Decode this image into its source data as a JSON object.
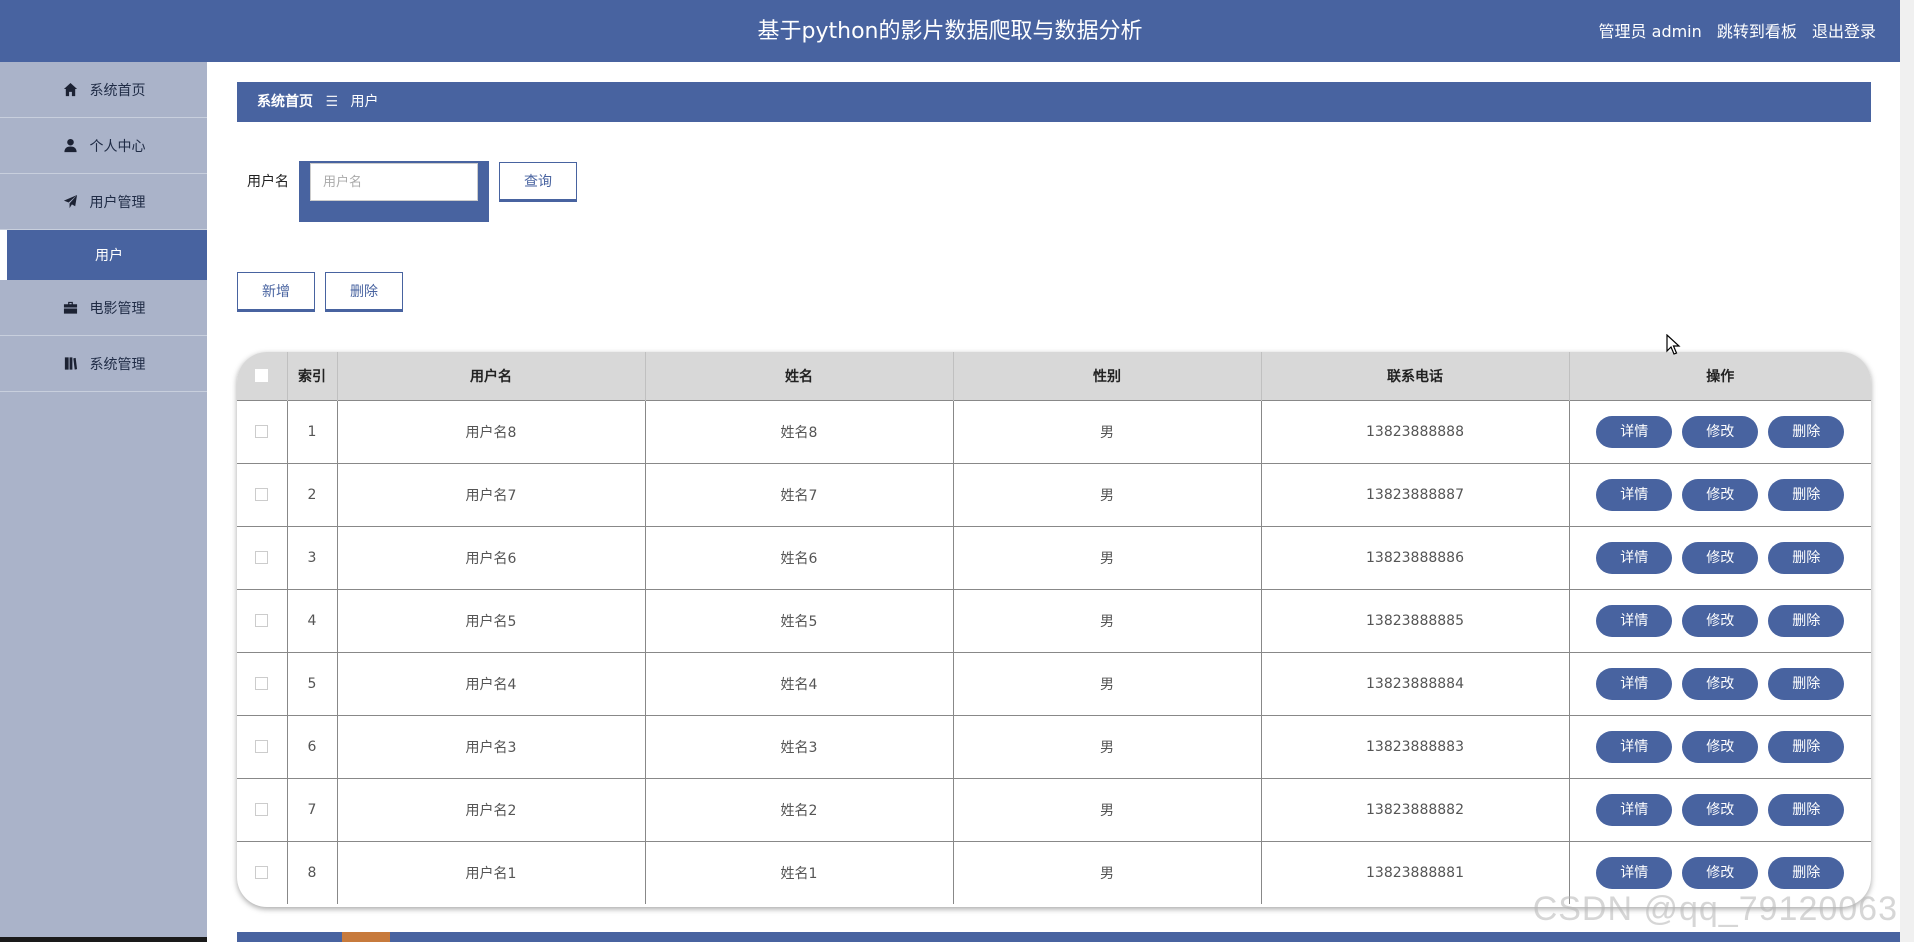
{
  "header": {
    "title": "基于python的影片数据爬取与数据分析",
    "admin_label": "管理员 admin",
    "dashboard_link": "跳转到看板",
    "logout_link": "退出登录"
  },
  "sidebar": {
    "items": [
      {
        "label": "系统首页",
        "icon": "home-icon"
      },
      {
        "label": "个人中心",
        "icon": "user-icon"
      },
      {
        "label": "用户管理",
        "icon": "paper-plane-icon"
      },
      {
        "label": "用户",
        "icon": ""
      },
      {
        "label": "电影管理",
        "icon": "briefcase-icon"
      },
      {
        "label": "系统管理",
        "icon": "book-icon"
      }
    ]
  },
  "breadcrumb": {
    "home": "系统首页",
    "separator": "☰",
    "current": "用户"
  },
  "search": {
    "label": "用户名",
    "placeholder": "用户名",
    "value": "",
    "button": "查询"
  },
  "actions": {
    "add": "新增",
    "delete": "删除"
  },
  "table": {
    "headers": [
      "索引",
      "用户名",
      "姓名",
      "性别",
      "联系电话",
      "操作"
    ],
    "op_labels": {
      "detail": "详情",
      "edit": "修改",
      "delete": "删除"
    },
    "rows": [
      {
        "index": "1",
        "username": "用户名8",
        "name": "姓名8",
        "gender": "男",
        "phone": "13823888888"
      },
      {
        "index": "2",
        "username": "用户名7",
        "name": "姓名7",
        "gender": "男",
        "phone": "13823888887"
      },
      {
        "index": "3",
        "username": "用户名6",
        "name": "姓名6",
        "gender": "男",
        "phone": "13823888886"
      },
      {
        "index": "4",
        "username": "用户名5",
        "name": "姓名5",
        "gender": "男",
        "phone": "13823888885"
      },
      {
        "index": "5",
        "username": "用户名4",
        "name": "姓名4",
        "gender": "男",
        "phone": "13823888884"
      },
      {
        "index": "6",
        "username": "用户名3",
        "name": "姓名3",
        "gender": "男",
        "phone": "13823888883"
      },
      {
        "index": "7",
        "username": "用户名2",
        "name": "姓名2",
        "gender": "男",
        "phone": "13823888882"
      },
      {
        "index": "8",
        "username": "用户名1",
        "name": "姓名1",
        "gender": "男",
        "phone": "13823888881"
      }
    ]
  },
  "watermark": "CSDN @qq_79120063",
  "colors": {
    "primary": "#4863a0",
    "sidebar_bg": "#aab3c9",
    "table_header_bg": "#d8d8d8"
  }
}
